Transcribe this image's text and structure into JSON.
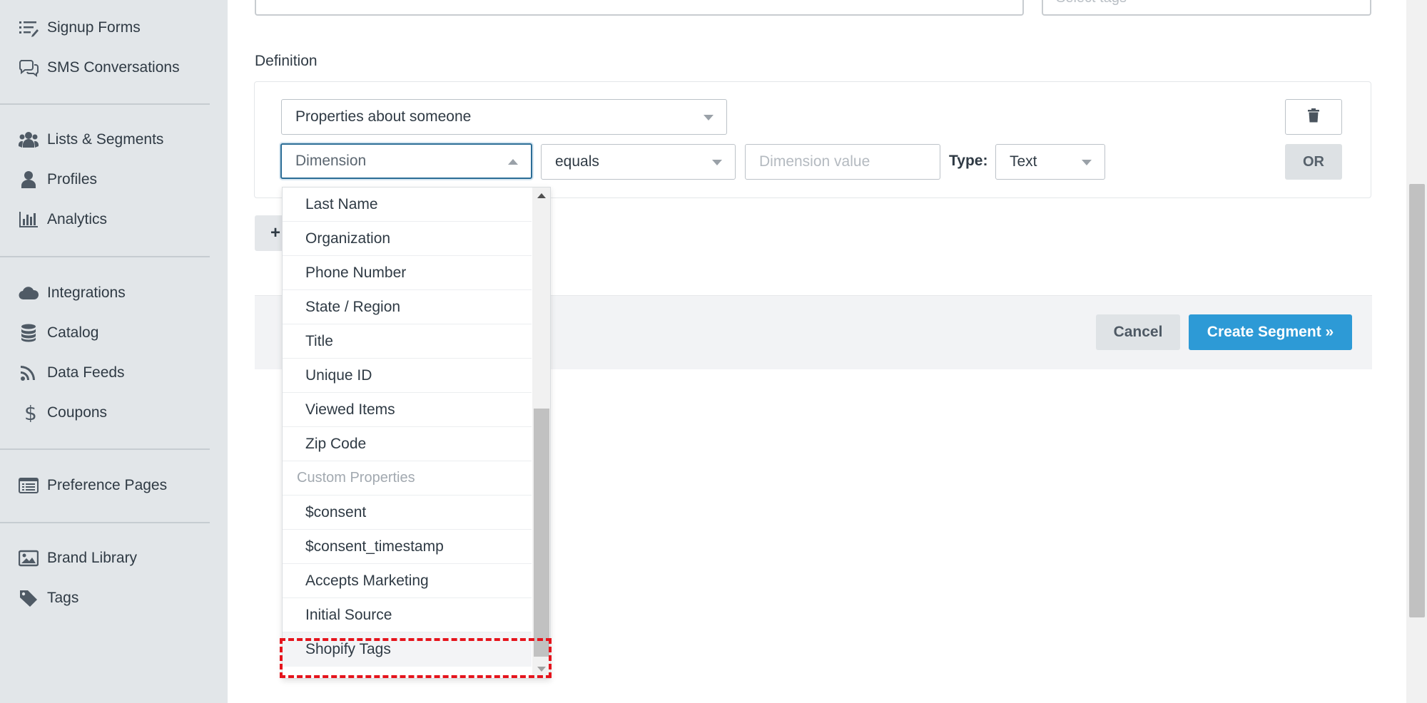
{
  "sidebar": {
    "items": [
      {
        "id": "signup-forms",
        "label": "Signup Forms",
        "icon": "list-icon"
      },
      {
        "id": "sms-conversations",
        "label": "SMS Conversations",
        "icon": "chat-bubbles-icon"
      },
      {
        "id": "lists-segments",
        "label": "Lists & Segments",
        "icon": "users-icon"
      },
      {
        "id": "profiles",
        "label": "Profiles",
        "icon": "person-icon"
      },
      {
        "id": "analytics",
        "label": "Analytics",
        "icon": "bar-chart-icon"
      },
      {
        "id": "integrations",
        "label": "Integrations",
        "icon": "cloud-icon"
      },
      {
        "id": "catalog",
        "label": "Catalog",
        "icon": "database-icon"
      },
      {
        "id": "data-feeds",
        "label": "Data Feeds",
        "icon": "rss-icon"
      },
      {
        "id": "coupons",
        "label": "Coupons",
        "icon": "dollar-icon"
      },
      {
        "id": "preference-pages",
        "label": "Preference Pages",
        "icon": "page-list-icon"
      },
      {
        "id": "brand-library",
        "label": "Brand Library",
        "icon": "image-icon"
      },
      {
        "id": "tags",
        "label": "Tags",
        "icon": "tag-icon"
      }
    ]
  },
  "form": {
    "tags_placeholder": "Select tags",
    "definition_label": "Definition",
    "condition_type": "Properties about someone",
    "dimension_placeholder": "Dimension",
    "operator": "equals",
    "dimension_value_placeholder": "Dimension value",
    "type_label": "Type:",
    "type_value": "Text",
    "or_label": "OR",
    "add_label": "+"
  },
  "footer": {
    "cancel_label": "Cancel",
    "create_label": "Create Segment »"
  },
  "dropdown": {
    "items": [
      {
        "label": "Last Name",
        "kind": "option"
      },
      {
        "label": "Organization",
        "kind": "option"
      },
      {
        "label": "Phone Number",
        "kind": "option"
      },
      {
        "label": "State / Region",
        "kind": "option"
      },
      {
        "label": "Title",
        "kind": "option"
      },
      {
        "label": "Unique ID",
        "kind": "option"
      },
      {
        "label": "Viewed Items",
        "kind": "option"
      },
      {
        "label": "Zip Code",
        "kind": "option"
      },
      {
        "label": "Custom Properties",
        "kind": "group"
      },
      {
        "label": "$consent",
        "kind": "option"
      },
      {
        "label": "$consent_timestamp",
        "kind": "option"
      },
      {
        "label": "Accepts Marketing",
        "kind": "option"
      },
      {
        "label": "Initial Source",
        "kind": "option"
      },
      {
        "label": "Shopify Tags",
        "kind": "option",
        "highlighted": true
      }
    ]
  },
  "colors": {
    "primary_button": "#2d9ad6",
    "highlight_outline": "#e5141c",
    "sidebar_bg": "#e2e6e9"
  }
}
